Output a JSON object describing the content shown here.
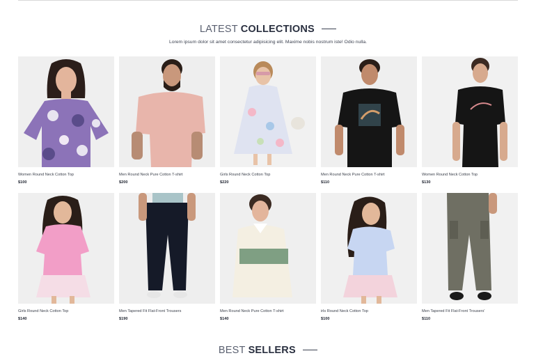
{
  "header": {
    "title_light": "LATEST",
    "title_bold": "COLLECTIONS",
    "subtitle": "Lorem ipsum dolor sit amet consectetur adipisicing elit. Maxime nobis nostrum iste! Odio nulla."
  },
  "products": [
    {
      "name": "Women Round Neck Cotton Top",
      "price": "$100"
    },
    {
      "name": "Men Round Neck Pure Cotton T-shirt",
      "price": "$200"
    },
    {
      "name": "Girls Round Neck Cotton Top",
      "price": "$220"
    },
    {
      "name": "Men Round Neck Pure Cotton T-shirt",
      "price": "$110"
    },
    {
      "name": "Women Round Neck Cotton Top",
      "price": "$130"
    },
    {
      "name": "Girls Round Neck Cotton Top",
      "price": "$140"
    },
    {
      "name": "Men Tapered Fit Flat-Front Trousers",
      "price": "$190"
    },
    {
      "name": "Men Round Neck Pure Cotton T-shirt",
      "price": "$140"
    },
    {
      "name": "irls Round Neck Cotton Top",
      "price": "$100"
    },
    {
      "name": "Men Tapered Fit Flat-Front Trousers'",
      "price": "$110"
    }
  ],
  "bestsellers": {
    "title_light": "BEST",
    "title_bold": "SELLERS"
  },
  "colors": {
    "image_bg": "#ececec",
    "text": "#1f2430"
  }
}
